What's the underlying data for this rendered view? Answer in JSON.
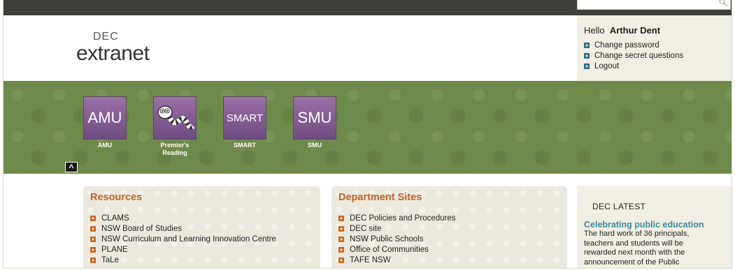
{
  "header": {
    "logo_small": "DEC",
    "logo_big": "extranet"
  },
  "search": {
    "icon": "search-icon"
  },
  "user": {
    "greeting": "Hello",
    "name": "Arthur Dent",
    "links": [
      "Change password",
      "Change secret questions",
      "Logout"
    ]
  },
  "tiles": [
    {
      "box_text": "AMU",
      "label": "AMU",
      "label2": ""
    },
    {
      "box_text": "",
      "label": "Premier's",
      "label2": "Reading"
    },
    {
      "box_text": "SMART",
      "label": "SMART",
      "label2": ""
    },
    {
      "box_text": "SMU",
      "label": "SMU",
      "label2": ""
    }
  ],
  "collapse_caret": "^",
  "resources": {
    "title": "Resources",
    "items": [
      "CLAMS",
      "NSW Board of Studies",
      "NSW Curriculum and Learning Innovation Centre",
      "PLANE",
      "TaLe"
    ]
  },
  "department": {
    "title": "Department Sites",
    "items": [
      "DEC Policies and Procedures",
      "DEC site",
      "NSW Public Schools",
      "Office of Communities",
      "TAFE NSW"
    ]
  },
  "latest": {
    "title": "DEC LATEST",
    "headline": "Celebrating public education",
    "body": "The hard work of 36 principals, teachers and students will be rewarded next month with the announcement of the Public"
  },
  "colors": {
    "accent_orange": "#c26324",
    "link_teal": "#3a8aa0",
    "banner_green": "#6e8a4a",
    "tile_purple": "#7d5a8c"
  }
}
